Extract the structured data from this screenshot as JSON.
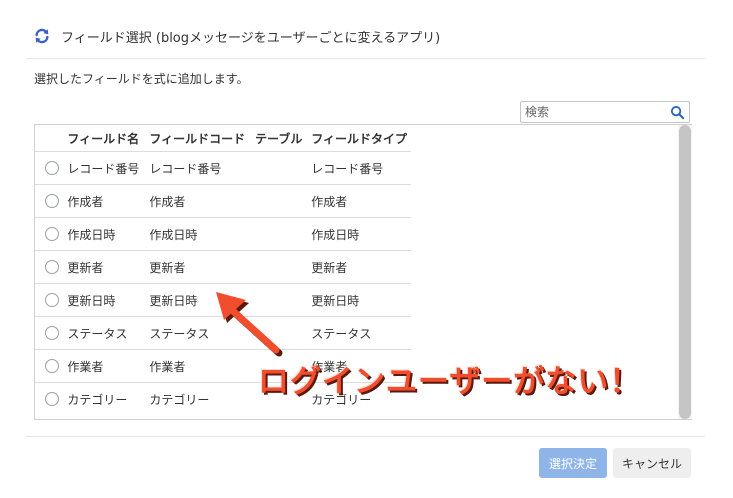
{
  "dialog": {
    "title": "フィールド選択 (blogメッセージをユーザーごとに変えるアプリ)",
    "instruction": "選択したフィールドを式に追加します。"
  },
  "search": {
    "placeholder": "検索",
    "value": ""
  },
  "table": {
    "headers": [
      "フィールド名",
      "フィールドコード",
      "テーブル",
      "フィールドタイプ"
    ],
    "rows": [
      {
        "name": "レコード番号",
        "code": "レコード番号",
        "table": "",
        "type": "レコード番号"
      },
      {
        "name": "作成者",
        "code": "作成者",
        "table": "",
        "type": "作成者"
      },
      {
        "name": "作成日時",
        "code": "作成日時",
        "table": "",
        "type": "作成日時"
      },
      {
        "name": "更新者",
        "code": "更新者",
        "table": "",
        "type": "更新者"
      },
      {
        "name": "更新日時",
        "code": "更新日時",
        "table": "",
        "type": "更新日時"
      },
      {
        "name": "ステータス",
        "code": "ステータス",
        "table": "",
        "type": "ステータス"
      },
      {
        "name": "作業者",
        "code": "作業者",
        "table": "",
        "type": "作業者"
      },
      {
        "name": "カテゴリー",
        "code": "カテゴリー",
        "table": "",
        "type": "カテゴリー"
      }
    ]
  },
  "buttons": {
    "confirm": "選択決定",
    "cancel": "キャンセル"
  },
  "annotation": {
    "text": "ログインユーザーがない！",
    "color": "#f24d2c"
  },
  "colors": {
    "accent": "#3b5fc7",
    "confirm_button": "#8fb4e8"
  }
}
